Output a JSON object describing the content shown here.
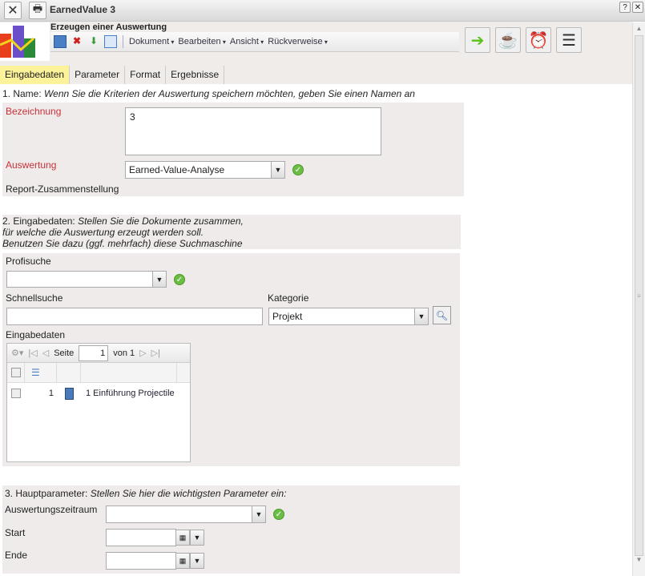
{
  "window": {
    "title": "EarnedValue 3",
    "help": "?",
    "close": "✕"
  },
  "header": {
    "subtitle": "Erzeugen einer Auswertung",
    "menus": [
      "Dokument",
      "Bearbeiten",
      "Ansicht",
      "Rückverweise"
    ]
  },
  "tabs": [
    "Eingabedaten",
    "Parameter",
    "Format",
    "Ergebnisse"
  ],
  "section1": {
    "heading_prefix": "1. Name:",
    "heading_text": "Wenn Sie die Kriterien der Auswertung speichern möchten, geben Sie einen Namen an",
    "bezeichnung_label": "Bezeichnung",
    "bezeichnung_value": "3",
    "auswertung_label": "Auswertung",
    "auswertung_value": "Earned-Value-Analyse",
    "report_label": "Report-Zusammenstellung"
  },
  "section2": {
    "heading_prefix": "2. Eingabedaten:",
    "heading_line1": "Stellen Sie die Dokumente zusammen,",
    "heading_line2": "für welche die Auswertung erzeugt werden soll.",
    "heading_line3": "Benutzen Sie dazu (ggf. mehrfach) diese Suchmaschine",
    "profisuche_label": "Profisuche",
    "profisuche_value": "",
    "schnellsuche_label": "Schnellsuche",
    "schnellsuche_value": "",
    "kategorie_label": "Kategorie",
    "kategorie_value": "Projekt",
    "grid_label": "Eingabedaten",
    "pager": {
      "page_label": "Seite",
      "page": "1",
      "of_label": "von 1"
    },
    "rows": [
      {
        "num": "1",
        "name": "1 Einführung Projectile"
      }
    ]
  },
  "section3": {
    "heading_prefix": "3. Hauptparameter:",
    "heading_text": "Stellen Sie hier die wichtigsten Parameter ein:",
    "zeitraum_label": "Auswertungszeitraum",
    "zeitraum_value": "",
    "start_label": "Start",
    "start_value": "",
    "ende_label": "Ende",
    "ende_value": ""
  }
}
